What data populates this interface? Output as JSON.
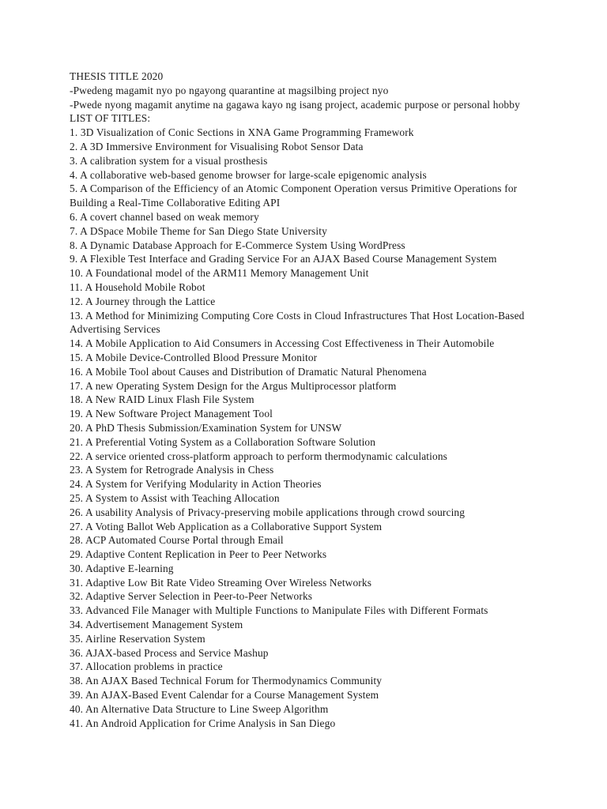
{
  "document": {
    "title_line": "THESIS TITLE 2020",
    "notes": [
      "-Pwedeng magamit nyo po ngayong quarantine at magsilbing project nyo",
      "-Pwede nyong magamit anytime na gagawa kayo ng isang project, academic purpose or personal hobby"
    ],
    "list_heading": "LIST OF TITLES:",
    "titles": [
      "1. 3D Visualization of Conic Sections in XNA Game Programming Framework",
      "2. A 3D Immersive Environment for Visualising Robot Sensor Data",
      "3. A calibration system for a visual prosthesis",
      "4. A collaborative web-based genome browser for large-scale epigenomic analysis",
      "5. A Comparison of the Efficiency of an Atomic Component Operation versus Primitive Operations for Building a Real-Time Collaborative Editing API",
      "6. A covert channel based on weak memory",
      "7. A DSpace Mobile Theme for San Diego State University",
      "8. A Dynamic Database Approach for E-Commerce System Using WordPress",
      "9. A Flexible Test Interface and Grading Service For an AJAX Based Course Management System",
      "10. A Foundational model of the ARM11 Memory Management Unit",
      "11. A Household Mobile Robot",
      "12. A Journey through the Lattice",
      "13. A Method for Minimizing Computing Core Costs in Cloud Infrastructures That Host Location-Based Advertising Services",
      "14. A Mobile Application to Aid Consumers in Accessing Cost Effectiveness in Their Automobile",
      "15. A Mobile Device-Controlled Blood Pressure Monitor",
      "16. A Mobile Tool about Causes and Distribution of Dramatic Natural Phenomena",
      "17. A new Operating System Design for the Argus Multiprocessor platform",
      "18. A New RAID Linux Flash File System",
      "19. A New Software Project Management Tool",
      "20. A PhD Thesis Submission/Examination System for UNSW",
      "21. A Preferential Voting System as a Collaboration Software Solution",
      "22. A service oriented cross-platform approach to perform thermodynamic calculations",
      "23. A System for Retrograde Analysis in Chess",
      "24. A System for Verifying Modularity in Action Theories",
      "25. A System to Assist with Teaching Allocation",
      "26. A usability Analysis of Privacy-preserving mobile applications through crowd sourcing",
      "27. A Voting Ballot Web Application as a Collaborative Support System",
      "28. ACP Automated Course Portal through Email",
      "29. Adaptive Content Replication in Peer to Peer Networks",
      "30. Adaptive E-learning",
      "31. Adaptive Low Bit Rate Video Streaming Over Wireless Networks",
      "32. Adaptive Server Selection in Peer-to-Peer Networks",
      "33. Advanced File Manager with Multiple Functions to Manipulate Files with Different Formats",
      "34. Advertisement Management System",
      "35. Airline Reservation System",
      "36. AJAX-based Process and Service Mashup",
      "37. Allocation problems in practice",
      "38. An AJAX Based Technical Forum for Thermodynamics Community",
      "39. An AJAX-Based Event Calendar for a Course Management System",
      "40. An Alternative Data Structure to Line Sweep Algorithm",
      "41. An Android Application for Crime Analysis in San Diego"
    ]
  }
}
